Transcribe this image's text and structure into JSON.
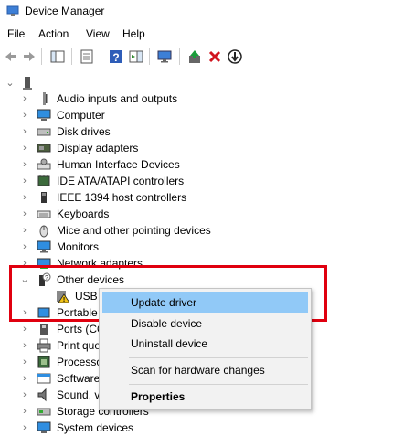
{
  "window": {
    "title": "Device Manager"
  },
  "menu": [
    "File",
    "Action",
    "View",
    "Help"
  ],
  "tree": {
    "categories": [
      {
        "label": "Audio inputs and outputs",
        "icon": "speaker-icon"
      },
      {
        "label": "Computer",
        "icon": "computer-icon"
      },
      {
        "label": "Disk drives",
        "icon": "disk-drive-icon"
      },
      {
        "label": "Display adapters",
        "icon": "display-adapter-icon"
      },
      {
        "label": "Human Interface Devices",
        "icon": "hid-icon"
      },
      {
        "label": "IDE ATA/ATAPI controllers",
        "icon": "ide-controller-icon"
      },
      {
        "label": "IEEE 1394 host controllers",
        "icon": "ieee1394-icon"
      },
      {
        "label": "Keyboards",
        "icon": "keyboard-icon"
      },
      {
        "label": "Mice and other pointing devices",
        "icon": "mouse-icon"
      },
      {
        "label": "Monitors",
        "icon": "monitor-icon"
      },
      {
        "label": "Network adapters",
        "icon": "network-adapter-icon"
      },
      {
        "label": "Other devices",
        "icon": "unknown-device-icon"
      },
      {
        "label": "USB S",
        "icon": "warning-device-icon"
      },
      {
        "label": "Portable",
        "icon": "portable-device-icon"
      },
      {
        "label": "Ports (CO",
        "icon": "port-icon"
      },
      {
        "label": "Print que",
        "icon": "printer-icon"
      },
      {
        "label": "Processo",
        "icon": "processor-icon"
      },
      {
        "label": "Software",
        "icon": "software-device-icon"
      },
      {
        "label": "Sound, v",
        "icon": "sound-icon"
      },
      {
        "label": "Storage controllers",
        "icon": "storage-controller-icon"
      },
      {
        "label": "System devices",
        "icon": "system-device-icon"
      }
    ]
  },
  "context_menu": {
    "items": [
      "Update driver",
      "Disable device",
      "Uninstall device",
      "Scan for hardware changes",
      "Properties"
    ]
  },
  "colors": {
    "highlight": "#e0000f",
    "menu_hover": "#91c9f7"
  }
}
